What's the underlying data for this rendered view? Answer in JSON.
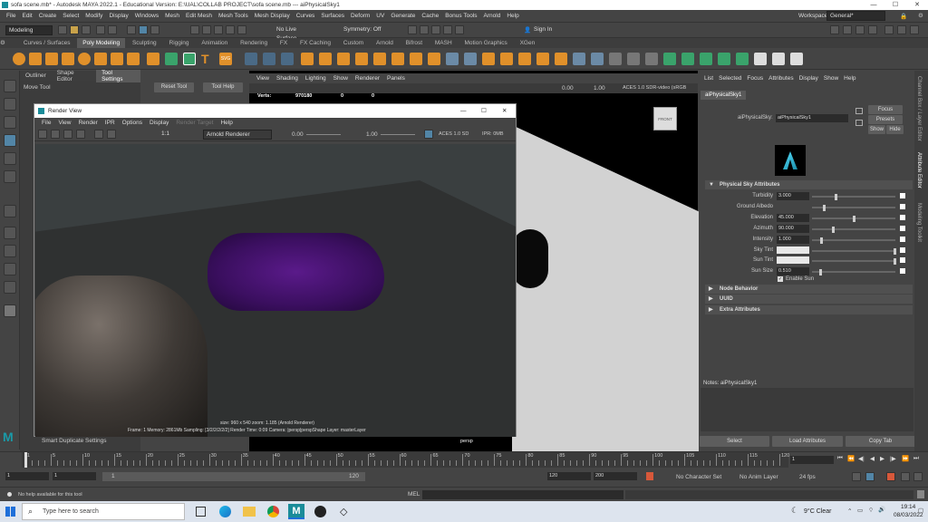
{
  "window": {
    "title": "sofa scene.mb* - Autodesk MAYA 2022.1 - Educational Version: E:\\UAL\\COLLAB PROJECT\\sofa scene.mb  ---  aiPhysicalSky1",
    "workspace_label": "Workspace :",
    "workspace_value": "General*"
  },
  "menus": [
    "File",
    "Edit",
    "Create",
    "Select",
    "Modify",
    "Display",
    "Windows",
    "Mesh",
    "Edit Mesh",
    "Mesh Tools",
    "Mesh Display",
    "Curves",
    "Surfaces",
    "Deform",
    "UV",
    "Generate",
    "Cache",
    "Bonus Tools",
    "Arnold",
    "Help"
  ],
  "statusline": {
    "mode": "Modeling",
    "live_surface": "No Live Surface",
    "symmetry": "Symmetry: Off",
    "sign_in": "Sign In"
  },
  "shelf_tabs": [
    "Curves / Surfaces",
    "Poly Modeling",
    "Sculpting",
    "Rigging",
    "Animation",
    "Rendering",
    "FX",
    "FX Caching",
    "Custom",
    "Arnold",
    "Bifrost",
    "MASH",
    "Motion Graphics",
    "XGen"
  ],
  "shelf_active": "Poly Modeling",
  "panel_tabs": {
    "outliner": "Outliner",
    "shape_editor": "Shape Editor",
    "tool_settings": "Tool Settings"
  },
  "tool_settings": {
    "tool_name": "Move Tool",
    "reset": "Reset Tool",
    "help": "Tool Help",
    "smart_duplicate": "Smart Duplicate Settings"
  },
  "viewport": {
    "menus": [
      "View",
      "Shading",
      "Lighting",
      "Show",
      "Renderer",
      "Panels"
    ],
    "hud_label": "Verts:",
    "hud_values": [
      "970180",
      "0",
      "0"
    ],
    "exposure": "0.00",
    "gamma": "1.00",
    "color_space": "ACES 1.0 SDR-video (sRGB",
    "camera_label": "persp",
    "cube_face": "FRONT"
  },
  "render_view": {
    "title": "Render View",
    "menus": [
      "File",
      "View",
      "Render",
      "IPR",
      "Options",
      "Display",
      "Render Target",
      "Help"
    ],
    "ratio": "1:1",
    "renderer": "Arnold Renderer",
    "exposure": "0.00",
    "gamma": "1.00",
    "color_space": "ACES 1.0 SD",
    "ipr": "IPR: 0MB",
    "size_line": "size: 960 x 540  zoom: 1.185     (Arnold Renderer)",
    "info_line": "Frame: 1    Memory: 2861Mb    Sampling: [3/2/2/2/2/2]    Render Time: 0:09    Camera: |persp|perspShape    Layer: masterLayer"
  },
  "attribute_editor": {
    "menus": [
      "List",
      "Selected",
      "Focus",
      "Attributes",
      "Display",
      "Show",
      "Help"
    ],
    "node_tab": "aiPhysicalSky1",
    "node_label": "aiPhysicalSky:",
    "node_value": "aiPhysicalSky1",
    "focus": "Focus",
    "presets": "Presets",
    "show": "Show",
    "hide": "Hide",
    "section_title": "Physical Sky Attributes",
    "attrs": [
      {
        "label": "Turbidity",
        "value": "3.000",
        "slider": 0.28
      },
      {
        "label": "Ground Albedo",
        "value": "",
        "slider": 0.14
      },
      {
        "label": "Elevation",
        "value": "45.000",
        "slider": 0.5
      },
      {
        "label": "Azimuth",
        "value": "90.000",
        "slider": 0.25
      },
      {
        "label": "Intensity",
        "value": "1.000",
        "slider": 0.1
      }
    ],
    "sky_tint": "Sky Tint",
    "sun_tint": "Sun Tint",
    "sun_size_label": "Sun Size",
    "sun_size_value": "0.510",
    "enable_sun": "Enable Sun",
    "collapsed_sections": [
      "Node Behavior",
      "UUID",
      "Extra Attributes"
    ],
    "notes": "Notes:  aiPhysicalSky1",
    "buttons": [
      "Select",
      "Load Attributes",
      "Copy Tab"
    ]
  },
  "side_tabs": [
    "Channel Box / Layer Editor",
    "Attribute Editor",
    "Modeling Toolkit"
  ],
  "timeline": {
    "ticks": [
      "1",
      "5",
      "10",
      "15",
      "20",
      "25",
      "30",
      "35",
      "40",
      "45",
      "50",
      "55",
      "60",
      "65",
      "70",
      "75",
      "80",
      "85",
      "90",
      "95",
      "100",
      "105",
      "110",
      "115",
      "120"
    ],
    "current_frame": "1",
    "start": "1",
    "inner_start": "1",
    "range_start": "1",
    "range_end": "120",
    "end_a": "120",
    "end_b": "200",
    "character_set": "No Character Set",
    "anim_layer": "No Anim Layer",
    "fps": "24 fps"
  },
  "command_line": {
    "help_text": "No help available for this tool",
    "mel": "MEL"
  },
  "taskbar": {
    "search_placeholder": "Type here to search",
    "weather": "9°C  Clear",
    "time": "19:14",
    "date": "08/03/2022"
  },
  "colors": {
    "accent": "#5285a6",
    "active_tab": "#5a5a5a",
    "bg": "#444444"
  }
}
